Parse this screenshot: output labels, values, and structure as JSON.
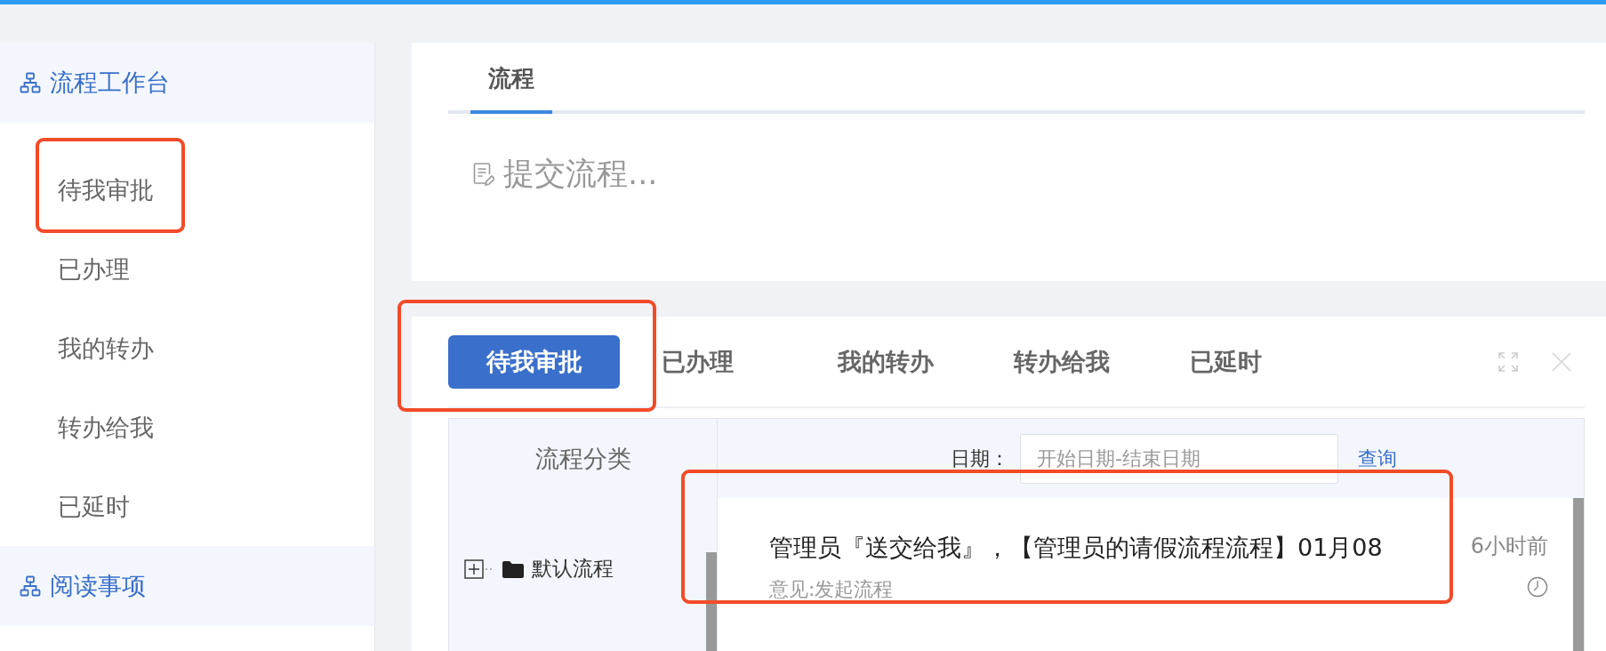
{
  "sidebar": {
    "sections": [
      {
        "title": "流程工作台",
        "items": [
          {
            "label": "待我审批"
          },
          {
            "label": "已办理"
          },
          {
            "label": "我的转办"
          },
          {
            "label": "转办给我"
          },
          {
            "label": "已延时"
          }
        ]
      },
      {
        "title": "阅读事项"
      }
    ]
  },
  "top_card": {
    "tabs": [
      {
        "label": "流程",
        "selected": true
      }
    ],
    "submit_link": "提交流程..."
  },
  "task_panel": {
    "tabs": [
      {
        "label": "待我审批",
        "selected": true
      },
      {
        "label": "已办理",
        "selected": false
      },
      {
        "label": "我的转办",
        "selected": false
      },
      {
        "label": "转办给我",
        "selected": false
      },
      {
        "label": "已延时",
        "selected": false
      }
    ],
    "category_header": "流程分类",
    "tree": [
      {
        "label": "默认流程",
        "expanded": false
      }
    ],
    "filter": {
      "label": "日期：",
      "placeholder": "开始日期-结束日期",
      "button": "查询"
    },
    "items": [
      {
        "title": "管理员『送交给我』，【管理员的请假流程流程】01月08",
        "comment": "意见:发起流程",
        "time": "6小时前"
      }
    ]
  }
}
